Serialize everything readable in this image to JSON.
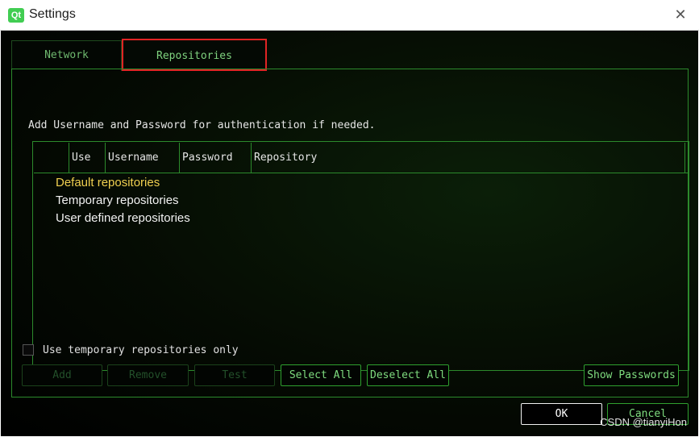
{
  "window": {
    "title": "Settings",
    "logo_text": "Qt",
    "close_symbol": "✕"
  },
  "tabs": [
    {
      "label": "Network",
      "active": false
    },
    {
      "label": "Repositories",
      "active": true
    }
  ],
  "repositories": {
    "hint": "Add Username and Password for authentication if needed.",
    "columns": [
      "",
      "Use",
      "Username",
      "Password",
      "Repository"
    ],
    "tree_items": [
      {
        "label": "Default repositories",
        "selected": true
      },
      {
        "label": "Temporary repositories",
        "selected": false
      },
      {
        "label": "User defined repositories",
        "selected": false
      }
    ],
    "temp_only_label": "Use temporary repositories only",
    "temp_only_checked": false,
    "buttons": {
      "add": "Add",
      "remove": "Remove",
      "test": "Test",
      "select_all": "Select All",
      "deselect_all": "Deselect All",
      "show_passwords": "Show Passwords"
    }
  },
  "dialog_buttons": {
    "ok": "OK",
    "cancel": "Cancel"
  },
  "watermark": "CSDN @tianyiHon",
  "colors": {
    "accent": "#2fa02f",
    "highlight_border": "#e02424",
    "selected_text": "#f0d050"
  }
}
